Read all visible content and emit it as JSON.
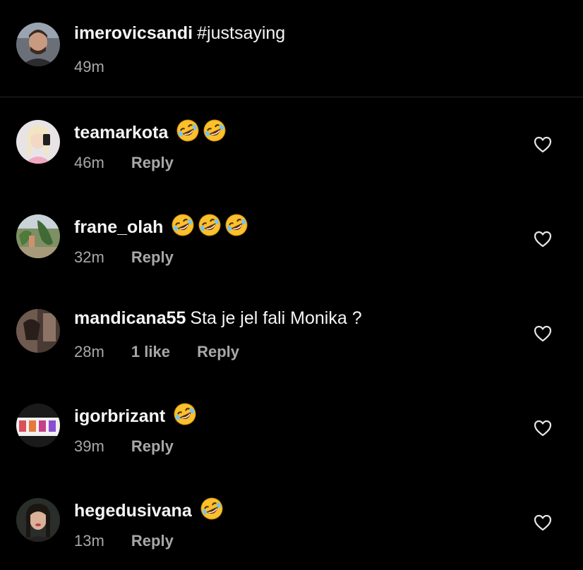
{
  "caption": {
    "username": "imerovicsandi",
    "text": "#justsaying",
    "time": "49m"
  },
  "comments": [
    {
      "username": "teamarkota",
      "text": "",
      "emoji_count": 2,
      "time": "46m",
      "likes": "",
      "reply": "Reply"
    },
    {
      "username": "frane_olah",
      "text": "",
      "emoji_count": 3,
      "time": "32m",
      "likes": "",
      "reply": "Reply"
    },
    {
      "username": "mandicana55",
      "text": "Sta je jel fali Monika ?",
      "emoji_count": 0,
      "time": "28m",
      "likes": "1 like",
      "reply": "Reply"
    },
    {
      "username": "igorbrizant",
      "text": "",
      "emoji_count": 1,
      "time": "39m",
      "likes": "",
      "reply": "Reply"
    },
    {
      "username": "hegedusivana",
      "text": "",
      "emoji_count": 1,
      "time": "13m",
      "likes": "",
      "reply": "Reply"
    }
  ],
  "icons": {
    "emoji": "rolling-on-floor-laughing-emoji",
    "like": "heart-outline-icon"
  },
  "colors": {
    "background": "#000000",
    "primary_text": "#f5f5f5",
    "secondary_text": "#a8a8a8",
    "divider": "#262626"
  }
}
